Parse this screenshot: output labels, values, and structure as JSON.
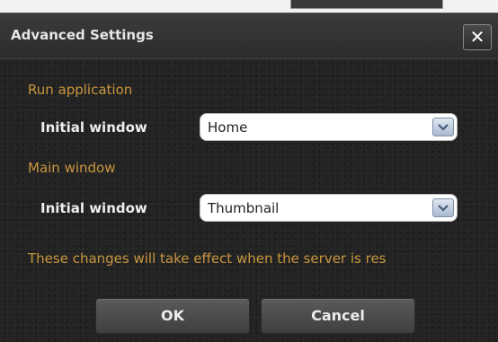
{
  "dialog": {
    "title": "Advanced Settings",
    "close_label": "✕"
  },
  "run_application": {
    "section_label": "Run application",
    "field_label": "Initial window",
    "selected_value": "Home"
  },
  "main_window": {
    "section_label": "Main window",
    "field_label": "Initial window",
    "selected_value": "Thumbnail"
  },
  "note": "These changes will take effect when the server is res",
  "buttons": {
    "ok_label": "OK",
    "cancel_label": "Cancel"
  },
  "icons": {
    "close": "close-icon",
    "dropdown": "chevron-down-icon"
  },
  "colors": {
    "accent_text": "#c9963e",
    "background": "#232323"
  }
}
